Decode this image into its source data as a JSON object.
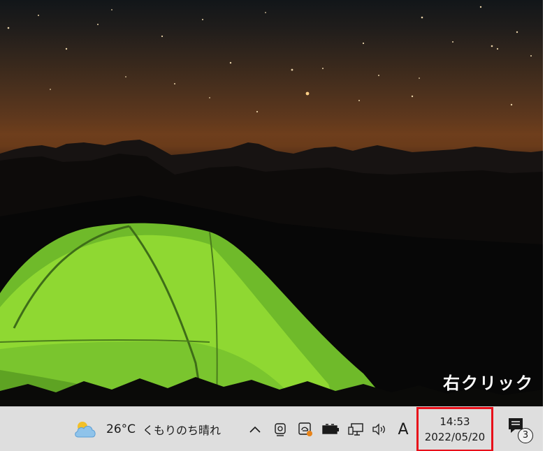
{
  "annotation": {
    "text": "右クリック",
    "highlight_color": "#e8101a"
  },
  "taskbar": {
    "weather": {
      "icon": "partly-cloudy-icon",
      "temperature": "26°C",
      "condition": "くもりのち晴れ"
    },
    "tray_icons": [
      "chevron-up-icon",
      "camera-icon",
      "onedrive-icon",
      "battery-icon",
      "network-icon",
      "volume-icon"
    ],
    "ime_mode": "A",
    "clock": {
      "time": "14:53",
      "date": "2022/05/20"
    },
    "notifications": {
      "icon": "notification-center-icon",
      "count": "3"
    }
  }
}
